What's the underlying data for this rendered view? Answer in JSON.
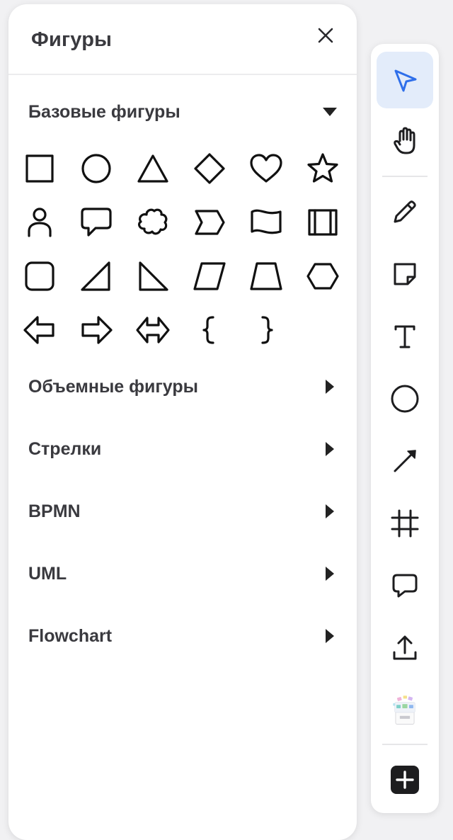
{
  "panel": {
    "title": "Фигуры",
    "close_icon": "close-icon",
    "basic_section": {
      "label": "Базовые фигуры",
      "expanded": true,
      "shapes": [
        "square",
        "circle",
        "triangle",
        "diamond",
        "heart",
        "star",
        "person",
        "speech-bubble",
        "cloud",
        "chevron",
        "flag-wave",
        "process",
        "rounded-square",
        "right-triangle",
        "left-right-triangle",
        "parallelogram",
        "trapezoid",
        "hexagon",
        "arrow-left",
        "arrow-right",
        "arrow-double",
        "brace-left",
        "brace-right"
      ]
    },
    "sections": [
      {
        "label": "Объемные фигуры",
        "expanded": false
      },
      {
        "label": "Стрелки",
        "expanded": false
      },
      {
        "label": "BPMN",
        "expanded": false
      },
      {
        "label": "UML",
        "expanded": false
      },
      {
        "label": "Flowchart",
        "expanded": false
      }
    ]
  },
  "toolbar": {
    "accent_color": "#2f6fea",
    "active_bg": "#e3ecfa",
    "tools": [
      {
        "icon": "cursor-icon",
        "active": true
      },
      {
        "icon": "hand-icon",
        "active": false
      },
      {
        "icon": "pencil-icon",
        "active": false
      },
      {
        "icon": "sticky-note-icon",
        "active": false
      },
      {
        "icon": "text-icon",
        "active": false
      },
      {
        "icon": "circle-icon",
        "active": false
      },
      {
        "icon": "arrow-icon",
        "active": false
      },
      {
        "icon": "frame-icon",
        "active": false
      },
      {
        "icon": "comment-icon",
        "active": false
      },
      {
        "icon": "upload-icon",
        "active": false
      },
      {
        "icon": "templates-icon",
        "active": false
      },
      {
        "icon": "plus-icon",
        "active": false
      }
    ]
  }
}
